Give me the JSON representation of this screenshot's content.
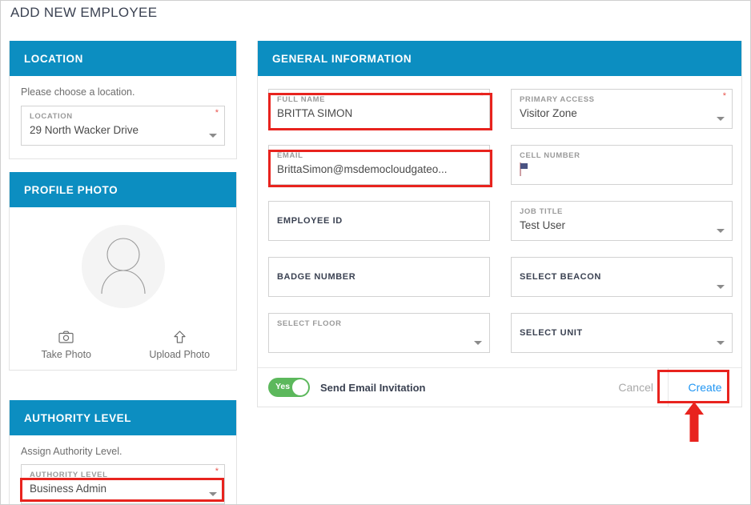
{
  "page": {
    "title": "ADD NEW EMPLOYEE"
  },
  "colors": {
    "header_blue": "#0c8ec1",
    "accent_link": "#2196f3",
    "highlight_red": "#e8231e",
    "toggle_green": "#5cb85c",
    "required_star": "#e8554e"
  },
  "location_panel": {
    "title": "LOCATION",
    "helper": "Please choose a location.",
    "field": {
      "label": "LOCATION",
      "value": "29 North Wacker Drive",
      "required": "*",
      "caret_icon": "chevron-down-icon"
    }
  },
  "profile_panel": {
    "title": "PROFILE PHOTO",
    "avatar_icon": "user-avatar-icon",
    "actions": [
      {
        "icon": "camera-icon",
        "label": "Take Photo"
      },
      {
        "icon": "upload-arrow-icon",
        "label": "Upload Photo"
      }
    ]
  },
  "authority_panel": {
    "title": "AUTHORITY LEVEL",
    "helper": "Assign Authority Level.",
    "field": {
      "label": "AUTHORITY LEVEL",
      "value": "Business Admin",
      "required": "*",
      "caret_icon": "chevron-down-icon"
    }
  },
  "general_panel": {
    "title": "GENERAL INFORMATION",
    "fields": [
      {
        "name": "full-name",
        "label": "FULL NAME",
        "value": "BRITTA SIMON",
        "required": "*",
        "type": "text",
        "highlighted": true,
        "label_style": "light"
      },
      {
        "name": "primary-access",
        "label": "PRIMARY ACCESS",
        "value": "Visitor Zone",
        "required": "*",
        "type": "select",
        "highlighted": false,
        "label_style": "light"
      },
      {
        "name": "email",
        "label": "EMAIL",
        "value": "BrittaSimon@msdemocloudgateo...",
        "required": "",
        "type": "text",
        "highlighted": true,
        "label_style": "light"
      },
      {
        "name": "cell-number",
        "label": "CELL NUMBER",
        "value": "",
        "required": "",
        "type": "phone",
        "highlighted": false,
        "label_style": "light",
        "flag_icon": "us-flag-icon"
      },
      {
        "name": "employee-id",
        "label": "EMPLOYEE ID",
        "value": "",
        "required": "",
        "type": "text",
        "highlighted": false,
        "label_style": "dark"
      },
      {
        "name": "job-title",
        "label": "JOB TITLE",
        "value": "Test User",
        "required": "",
        "type": "select",
        "highlighted": false,
        "label_style": "light"
      },
      {
        "name": "badge-number",
        "label": "BADGE NUMBER",
        "value": "",
        "required": "",
        "type": "text",
        "highlighted": false,
        "label_style": "dark"
      },
      {
        "name": "select-beacon",
        "label": "SELECT BEACON",
        "value": "",
        "required": "",
        "type": "select",
        "highlighted": false,
        "label_style": "dark"
      },
      {
        "name": "select-floor",
        "label": "SELECT FLOOR",
        "value": "",
        "required": "",
        "type": "select",
        "highlighted": false,
        "label_style": "light"
      },
      {
        "name": "select-unit",
        "label": "SELECT UNIT",
        "value": "",
        "required": "",
        "type": "select",
        "highlighted": false,
        "label_style": "dark"
      }
    ],
    "footer": {
      "toggle_state": "Yes",
      "toggle_label": "Send Email Invitation",
      "cancel_label": "Cancel",
      "create_label": "Create"
    }
  },
  "annotations": {
    "arrow_icon": "up-arrow-annotation",
    "highlighted_targets": [
      "full-name",
      "email",
      "authority-level",
      "create-button"
    ]
  }
}
